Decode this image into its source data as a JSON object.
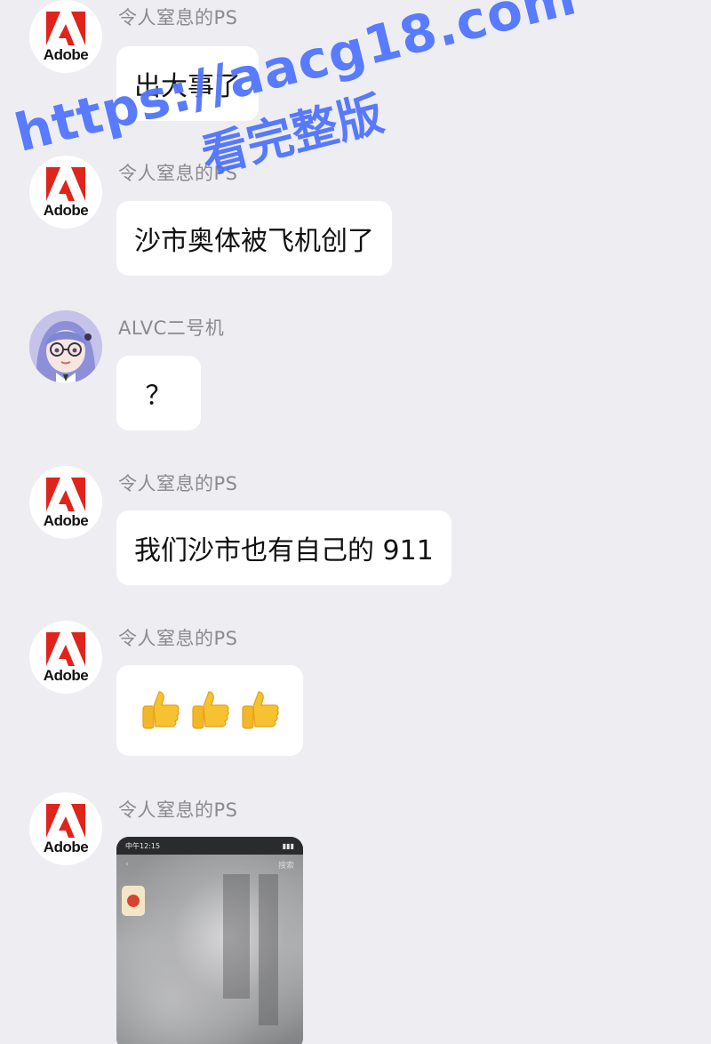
{
  "messages": [
    {
      "sender": "令人窒息的PS",
      "avatar_label": "Adobe",
      "text": "出大事了"
    },
    {
      "sender": "令人窒息的PS",
      "avatar_label": "Adobe",
      "text": "沙市奥体被飞机创了"
    },
    {
      "sender": "ALVC二号机",
      "avatar_label": "",
      "text": "？"
    },
    {
      "sender": "令人窒息的PS",
      "avatar_label": "Adobe",
      "text": "我们沙市也有自己的 911"
    },
    {
      "sender": "令人窒息的PS",
      "avatar_label": "Adobe",
      "emoji_count": 3,
      "emoji_icon": "thumbs-up-icon"
    },
    {
      "sender": "令人窒息的PS",
      "avatar_label": "Adobe",
      "attachment": "video-screenshot"
    }
  ],
  "video_card": {
    "status_time": "中午12:15",
    "search_label": "搜索"
  },
  "watermark": {
    "url": "https://aacg18.com",
    "subtitle": "看完整版"
  },
  "colors": {
    "background": "#ededf2",
    "bubble": "#ffffff",
    "adobe_red": "#e0241b",
    "watermark": "#4269ff"
  }
}
